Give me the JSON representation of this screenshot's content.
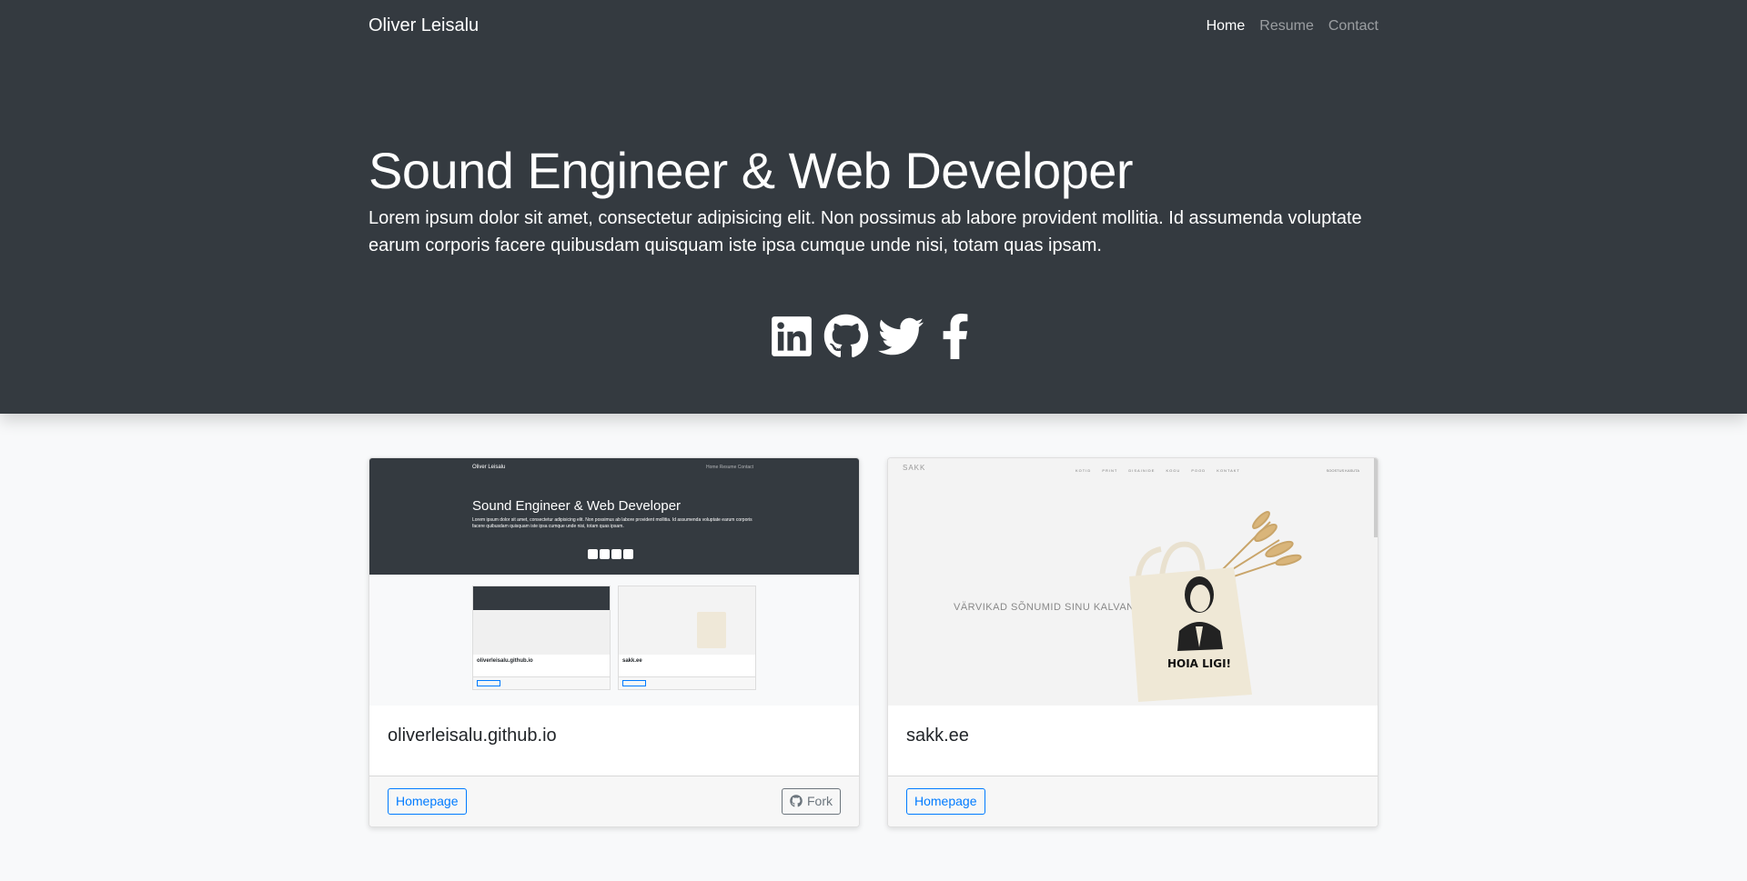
{
  "nav": {
    "brand": "Oliver Leisalu",
    "links": [
      {
        "label": "Home",
        "active": true
      },
      {
        "label": "Resume",
        "active": false
      },
      {
        "label": "Contact",
        "active": false
      }
    ]
  },
  "hero": {
    "title": "Sound Engineer & Web Developer",
    "lead": "Lorem ipsum dolor sit amet, consectetur adipisicing elit. Non possimus ab labore provident mollitia. Id assumenda voluptate earum corporis facere quibusdam quisquam iste ipsa cumque unde nisi, totam quas ipsam.",
    "socials": [
      "linkedin-icon",
      "github-icon",
      "twitter-icon",
      "facebook-icon"
    ]
  },
  "projects": [
    {
      "title": "oliverleisalu.github.io",
      "homepage_label": "Homepage",
      "fork_label": "Fork",
      "preview": {
        "brand": "Oliver Leisalu",
        "nav": "Home  Resume  Contact",
        "title": "Sound Engineer & Web Developer",
        "lead": "Lorem ipsum dolor sit amet, consectetur adipisicing elit. Non possimus ab labore provident mollitia. Id assumenda voluptate earum corporis facere quibusdam quisquam iste ipsa cumque unde nisi, totam quas ipsam.",
        "card1_label": "oliverleisalu.github.io",
        "card2_label": "sakk.ee"
      }
    },
    {
      "title": "sakk.ee",
      "homepage_label": "Homepage",
      "preview": {
        "logo": "SAKK",
        "menu": "KOTID PRINT DISAINIDE KOGU POOD KONTAKT",
        "right": "SOOSTUS KASUTA",
        "slogan": "VÄRVIKAD SÕNUMID SINU KALVANGU",
        "bag_text": "HOIA LIGI!"
      }
    }
  ],
  "colors": {
    "hero_bg": "#343a40",
    "page_bg": "#f8f9fa",
    "primary": "#007bff",
    "secondary": "#6c757d"
  }
}
